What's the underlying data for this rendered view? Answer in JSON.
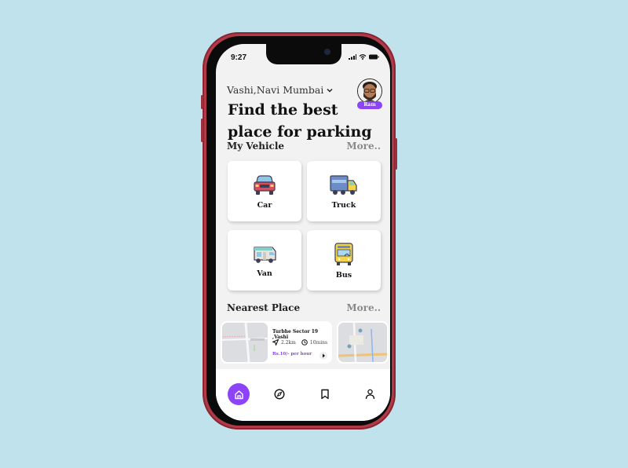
{
  "status_bar": {
    "time": "9:27"
  },
  "header": {
    "location": "Vashi,Navi Mumbai",
    "user_badge": "Ram",
    "title_line1": "Find the best",
    "title_line2": "place for parking"
  },
  "vehicles": {
    "title": "My Vehicle",
    "more_label": "More..",
    "items": [
      {
        "label": "Car",
        "icon": "car-icon"
      },
      {
        "label": "Truck",
        "icon": "truck-icon"
      },
      {
        "label": "Van",
        "icon": "van-icon"
      },
      {
        "label": "Bus",
        "icon": "bus-icon"
      }
    ]
  },
  "nearest": {
    "title": "Nearest Place",
    "more_label": "More..",
    "places": [
      {
        "name": "Turbhe Sector 19 ,Vashi",
        "distance": "2.2km",
        "time": "10mins",
        "price": "Rs.10/- per hour"
      }
    ]
  },
  "nav": {
    "items": [
      {
        "name": "home",
        "icon": "home-icon",
        "active": true
      },
      {
        "name": "explore",
        "icon": "compass-icon",
        "active": false
      },
      {
        "name": "saved",
        "icon": "bookmark-icon",
        "active": false
      },
      {
        "name": "profile",
        "icon": "user-icon",
        "active": false
      }
    ]
  },
  "colors": {
    "accent": "#8b44f7",
    "phone_frame": "#b23a48",
    "background": "#bfe2ec"
  }
}
